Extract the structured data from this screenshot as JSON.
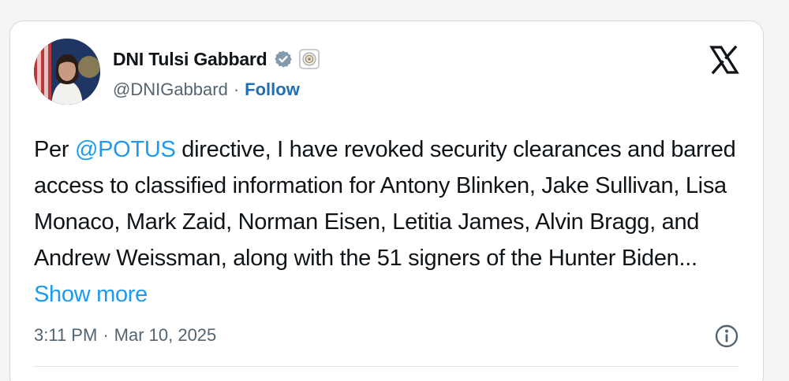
{
  "author": {
    "display_name": "DNI Tulsi Gabbard",
    "handle": "@DNIGabbard",
    "separator": "·",
    "follow_label": "Follow",
    "verified_badge_icon": "verified-badge-icon",
    "affiliation_icon": "government-seal-icon",
    "avatar": "avatar"
  },
  "platform": {
    "logo_icon": "x-logo-icon"
  },
  "tweet": {
    "text_before": "Per ",
    "mention": "@POTUS",
    "text_after": " directive, I have revoked security clearances and barred access to classified information for Antony Blinken, Jake Sullivan, Lisa Monaco, Mark Zaid, Norman Eisen, Letitia James, Alvin Bragg, and Andrew Weissman, along with the 51 signers of the Hunter Biden... ",
    "show_more_label": "Show more"
  },
  "meta": {
    "time": "3:11 PM",
    "separator": "·",
    "date": "Mar 10, 2025",
    "info_icon": "info-icon"
  },
  "colors": {
    "link": "#1d9bf0",
    "text": "#0f1419",
    "muted": "#536471",
    "verified": "#829aab"
  }
}
